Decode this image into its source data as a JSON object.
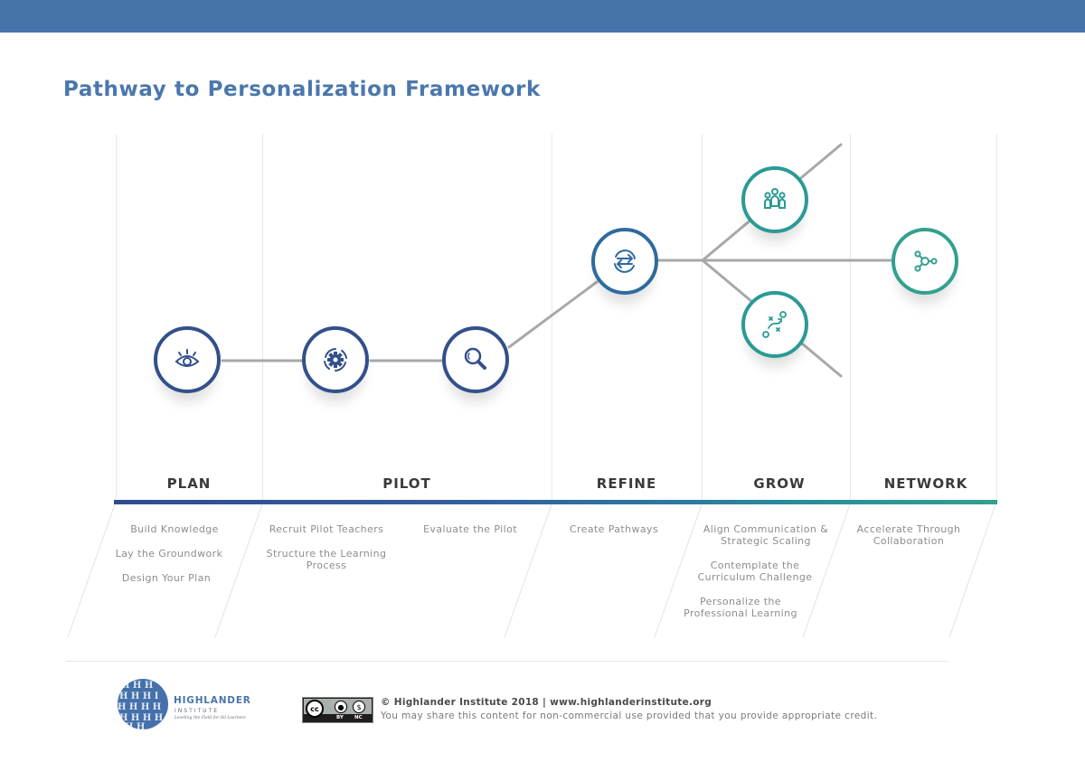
{
  "header": {
    "title": "Pathway to Personalization Framework",
    "bar_color": "#4674aa"
  },
  "colors": {
    "navy": "#33508c",
    "blue": "#2e6a9e",
    "teal": "#2b9a95",
    "green_teal": "#33a08e",
    "connector": "#a8a8a8"
  },
  "nodes": [
    {
      "id": "plan",
      "icon": "eye-icon",
      "phase": "PLAN"
    },
    {
      "id": "pilot-build",
      "icon": "gear-cycle-icon",
      "phase": "PILOT"
    },
    {
      "id": "pilot-evaluate",
      "icon": "magnifier-icon",
      "phase": "PILOT"
    },
    {
      "id": "refine",
      "icon": "exchange-arrows-icon",
      "phase": "REFINE"
    },
    {
      "id": "grow-people",
      "icon": "people-group-icon",
      "phase": "GROW"
    },
    {
      "id": "grow-strategy",
      "icon": "strategy-play-icon",
      "phase": "GROW"
    },
    {
      "id": "network",
      "icon": "network-nodes-icon",
      "phase": "NETWORK"
    }
  ],
  "phases": [
    {
      "label": "PLAN",
      "steps": [
        "Build Knowledge",
        "Lay the Groundwork",
        "Design Your Plan"
      ]
    },
    {
      "label": "PILOT",
      "steps": [
        "Recruit Pilot Teachers",
        "Structure the Learning\nProcess",
        "Evaluate the Pilot"
      ]
    },
    {
      "label": "REFINE",
      "steps": [
        "Create Pathways"
      ]
    },
    {
      "label": "GROW",
      "steps": [
        "Align Communication &\nStrategic Scaling",
        "Contemplate the\nCurriculum Challenge",
        "Personalize the\nProfessional Learning"
      ]
    },
    {
      "label": "NETWORK",
      "steps": [
        "Accelerate Through\nCollaboration"
      ]
    }
  ],
  "footer": {
    "org_name": "HIGHLANDER",
    "org_sub": "INSTITUTE",
    "org_tagline": "Leveling the Field for All Learners",
    "license_badge": {
      "cc": "cc",
      "by": "BY",
      "nc": "NC"
    },
    "copyright": "© Highlander Institute 2018 | www.highlanderinstitute.org",
    "notice": "You may share this content for non-commercial use provided that you provide appropriate credit."
  }
}
